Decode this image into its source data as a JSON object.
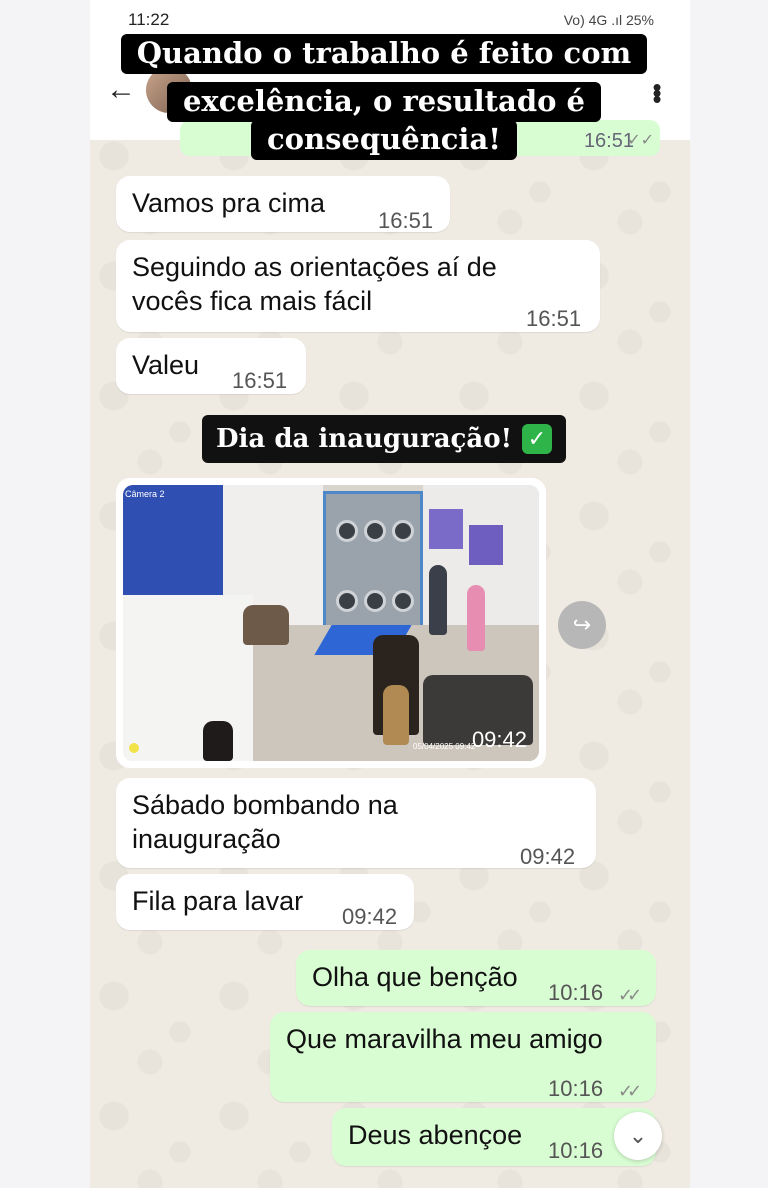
{
  "status_bar": {
    "time": "11:22",
    "right": "Vo) 4G .ıl 25%"
  },
  "overlay_caption": {
    "line1": "Quando o trabalho é feito com",
    "line2": "excelência, o resultado é",
    "line3": "consequência!"
  },
  "top_message": {
    "time": "16:51",
    "ticks": "✓✓"
  },
  "messages": [
    {
      "text": "Vamos pra cima",
      "time": "16:51"
    },
    {
      "text_line1": "Seguindo as orientações aí de",
      "text_line2": "vocês fica mais fácil",
      "time": "16:51"
    },
    {
      "text": "Valeu",
      "time": "16:51"
    }
  ],
  "day_label": {
    "text": "Dia da inauguração!",
    "emoji": "✓"
  },
  "video_message": {
    "camera_label": "Câmera 2",
    "overlay_time": "09:42",
    "date_stamp": "05/04/2025 09:42"
  },
  "after_video": [
    {
      "text_line1": "Sábado bombando na",
      "text_line2": "inauguração",
      "time": "09:42"
    },
    {
      "text": "Fila para lavar",
      "time": "09:42"
    }
  ],
  "outgoing": [
    {
      "text": "Olha que benção",
      "time": "10:16",
      "ticks": "✓✓"
    },
    {
      "text": "Que maravilha meu amigo",
      "time": "10:16",
      "ticks": "✓✓"
    },
    {
      "text": "Deus abençoe",
      "time": "10:16"
    }
  ],
  "icons": {
    "back": "←",
    "menu": "⋮",
    "forward": "↪",
    "scroll_down": "⌄"
  },
  "colors": {
    "chat_bg": "#efeae2",
    "incoming": "#ffffff",
    "outgoing": "#d9fdd3",
    "caption_bg": "#000000",
    "check_green": "#2fb44a"
  }
}
